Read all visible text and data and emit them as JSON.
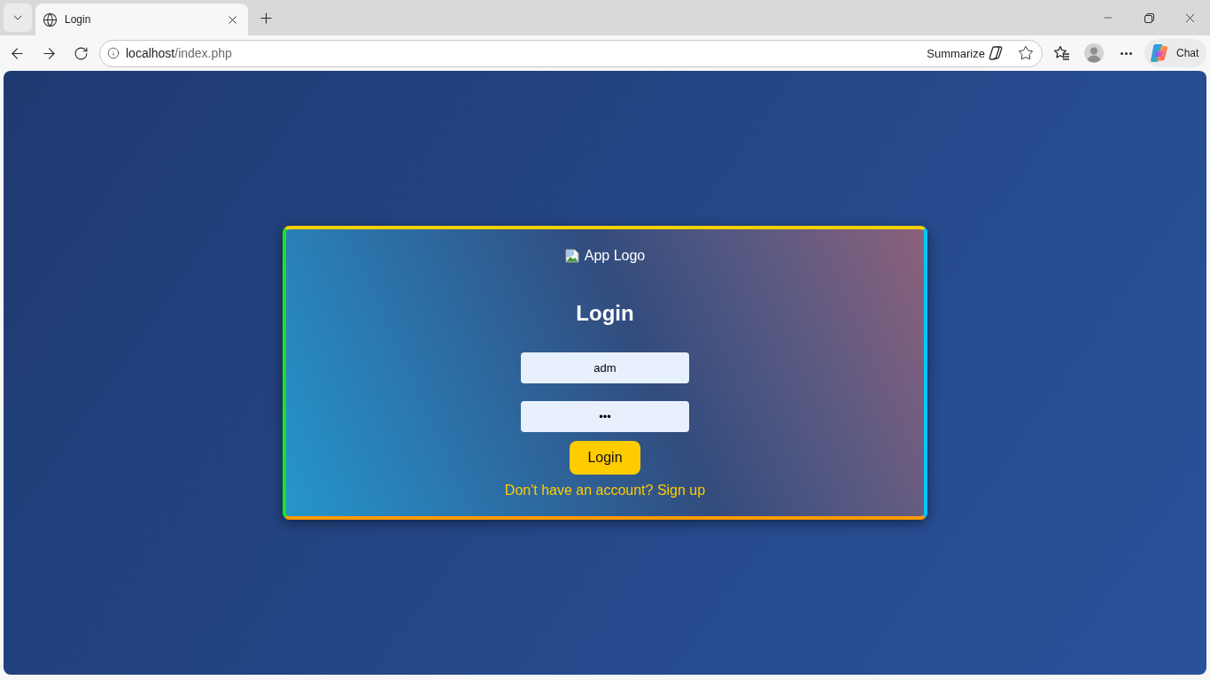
{
  "browser": {
    "tabs": [
      {
        "title": "Login",
        "selected": true
      }
    ],
    "address": {
      "host": "localhost",
      "path": "/index.php"
    },
    "toolbar": {
      "summarize": "Summarize",
      "chat": "Chat"
    }
  },
  "login_card": {
    "logo_alt": "App Logo",
    "title": "Login",
    "fields": [
      {
        "kind": "text",
        "value": "adm"
      },
      {
        "kind": "password",
        "value": "•••"
      }
    ],
    "submit": "Login",
    "signup_link": "Don't have an account? Sign up"
  }
}
